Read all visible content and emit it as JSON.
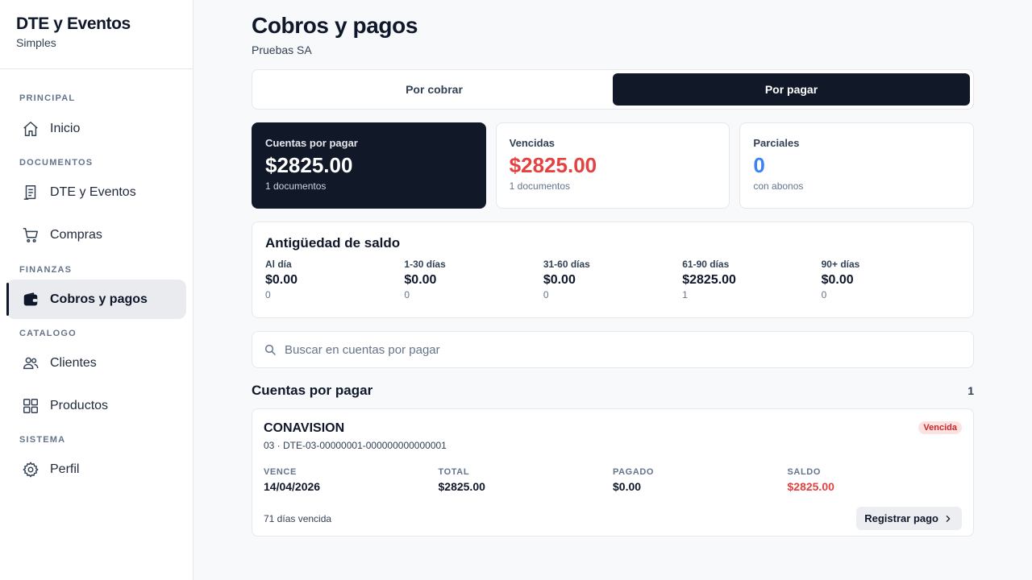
{
  "app": {
    "title": "DTE y Eventos",
    "subtitle": "Simples"
  },
  "sidebar": {
    "sections": [
      {
        "label": "PRINCIPAL"
      },
      {
        "label": "DOCUMENTOS"
      },
      {
        "label": "FINANZAS"
      },
      {
        "label": "CATALOGO"
      },
      {
        "label": "SISTEMA"
      }
    ],
    "items": [
      {
        "label": "Inicio",
        "icon": "home-icon"
      },
      {
        "label": "DTE y Eventos",
        "icon": "document-icon"
      },
      {
        "label": "Compras",
        "icon": "cart-icon"
      },
      {
        "label": "Cobros y pagos",
        "icon": "wallet-icon",
        "active": true
      },
      {
        "label": "Clientes",
        "icon": "users-icon"
      },
      {
        "label": "Productos",
        "icon": "grid-icon"
      },
      {
        "label": "Perfil",
        "icon": "gear-icon"
      }
    ]
  },
  "page": {
    "title": "Cobros y pagos",
    "subtitle": "Pruebas SA"
  },
  "tabs": [
    {
      "label": "Por cobrar",
      "active": false
    },
    {
      "label": "Por pagar",
      "active": true
    }
  ],
  "summary": [
    {
      "label": "Cuentas por pagar",
      "value": "$2825.00",
      "sub": "1 documentos"
    },
    {
      "label": "Vencidas",
      "value": "$2825.00",
      "sub": "1 documentos"
    },
    {
      "label": "Parciales",
      "value": "0",
      "sub": "con abonos"
    }
  ],
  "aging": {
    "title": "Antigüedad de saldo",
    "buckets": [
      {
        "label": "Al día",
        "value": "$0.00",
        "count": "0"
      },
      {
        "label": "1-30 días",
        "value": "$0.00",
        "count": "0"
      },
      {
        "label": "31-60 días",
        "value": "$0.00",
        "count": "0"
      },
      {
        "label": "61-90 días",
        "value": "$2825.00",
        "count": "1"
      },
      {
        "label": "90+ días",
        "value": "$0.00",
        "count": "0"
      }
    ]
  },
  "search": {
    "placeholder": "Buscar en cuentas por pagar",
    "value": ""
  },
  "list": {
    "title": "Cuentas por pagar",
    "count": "1",
    "items": [
      {
        "name": "CONAVISION",
        "doc": "03 · DTE-03-00000001-000000000000001",
        "status": "Vencida",
        "fields": [
          {
            "label": "VENCE",
            "value": "14/04/2026"
          },
          {
            "label": "TOTAL",
            "value": "$2825.00"
          },
          {
            "label": "PAGADO",
            "value": "$0.00"
          },
          {
            "label": "SALDO",
            "value": "$2825.00"
          }
        ],
        "overdue": "71 días vencida",
        "action": "Registrar pago"
      }
    ]
  },
  "colors": {
    "accent_dark": "#111827",
    "danger": "#e44141",
    "info": "#3b82f6",
    "badge_bg": "#fde2e2"
  }
}
